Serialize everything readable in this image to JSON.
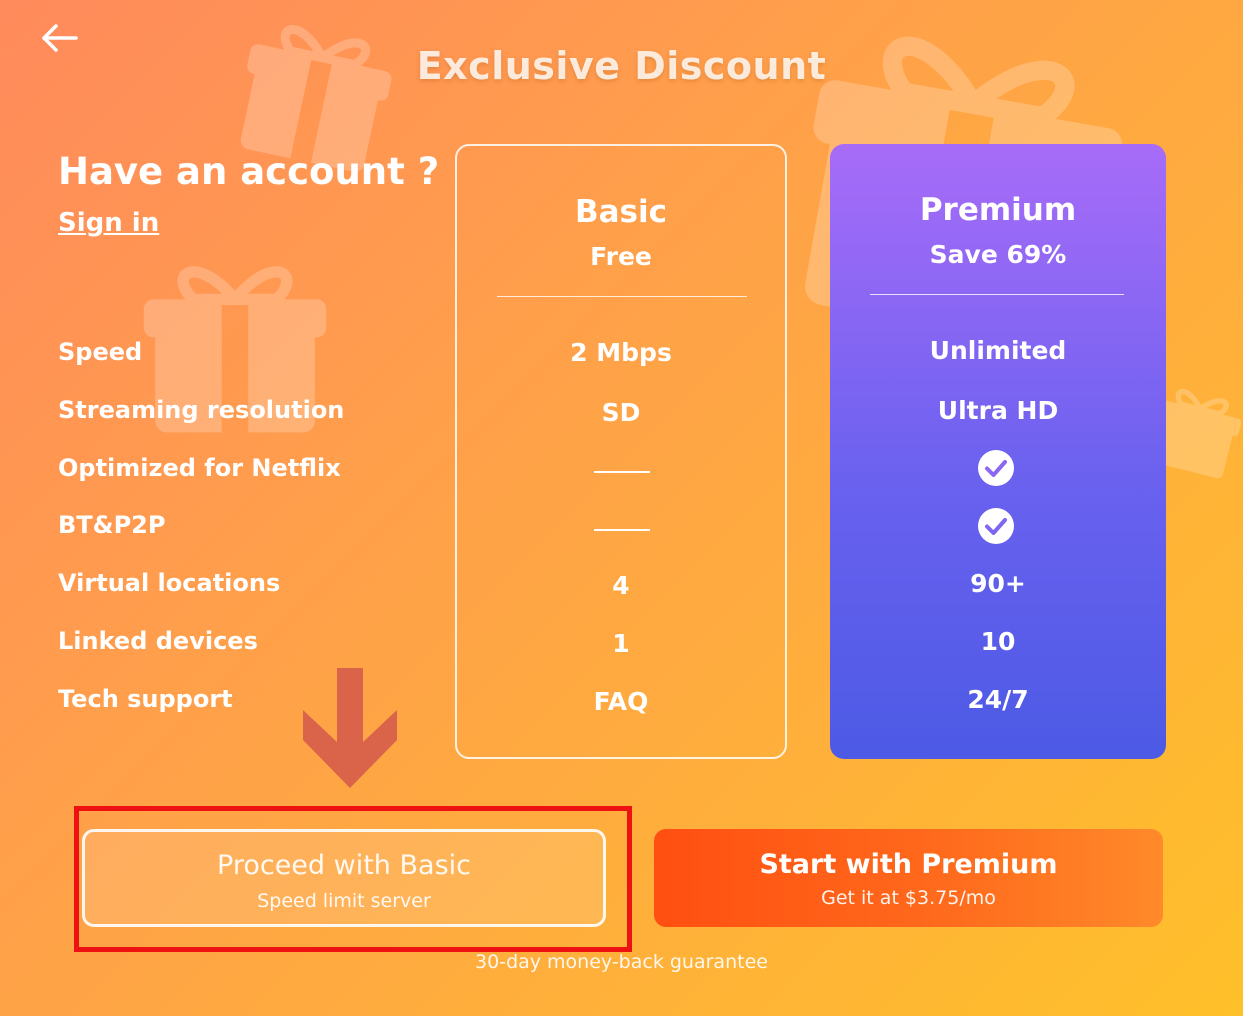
{
  "header": {
    "title": "Exclusive Discount"
  },
  "account": {
    "prompt": "Have an account ?",
    "sign_in": "Sign in"
  },
  "features": [
    "Speed",
    "Streaming resolution",
    "Optimized for Netflix",
    "BT&P2P",
    "Virtual locations",
    "Linked devices",
    "Tech support"
  ],
  "plans": {
    "basic": {
      "name": "Basic",
      "subtitle": "Free",
      "speed": "2 Mbps",
      "resolution": "SD",
      "netflix": "not-included",
      "p2p": "not-included",
      "locations": "4",
      "devices": "1",
      "support": "FAQ"
    },
    "premium": {
      "name": "Premium",
      "subtitle": "Save 69%",
      "speed": "Unlimited",
      "resolution": "Ultra HD",
      "netflix": "included",
      "p2p": "included",
      "locations": "90+",
      "devices": "10",
      "support": "24/7"
    }
  },
  "buttons": {
    "basic": {
      "label": "Proceed with Basic",
      "sub": "Speed limit server"
    },
    "premium": {
      "label": "Start with Premium",
      "sub": "Get it at $3.75/mo"
    }
  },
  "footer": {
    "guarantee": "30-day money-back guarantee"
  },
  "icons": {
    "back": "arrow-left-icon",
    "check": "check-circle-icon",
    "dash": "dash-icon",
    "pointer": "arrow-down-icon",
    "background": "gift-icon"
  },
  "colors": {
    "background_from": "#ff8a5c",
    "background_to": "#ffc02a",
    "premium_card_top": "#a76cf8",
    "premium_card_bottom": "#4c5ae5",
    "premium_button": "#ff4f11",
    "highlight_box": "#ee1111",
    "pointer_arrow": "#d9644a"
  }
}
